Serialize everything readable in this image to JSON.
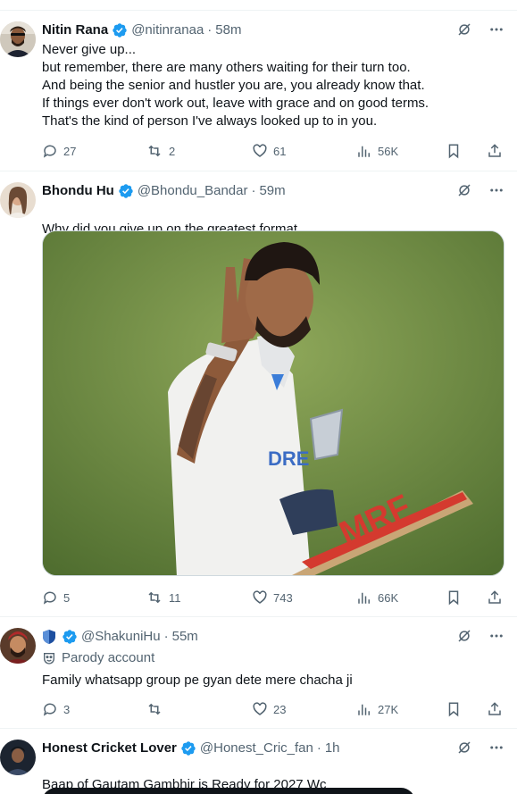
{
  "tweets": [
    {
      "name": "Nitin Rana",
      "handle": "@nitinranaa",
      "time": "58m",
      "text": "Never give up...\nbut remember, there are many others waiting for their turn too.\nAnd being the senior and hustler you are, you already know that.\nIf things ever don't work out, leave with grace and on good terms.\nThat's the kind of person I've always looked up to in you.",
      "replies": "27",
      "retweets": "2",
      "likes": "61",
      "views": "56K"
    },
    {
      "name": "Bhondu Hu",
      "handle": "@Bhondu_Bandar",
      "time": "59m",
      "text": "Why did you give up on the greatest format",
      "replies": "5",
      "retweets": "11",
      "likes": "743",
      "views": "66K"
    },
    {
      "name": "",
      "handle": "@ShakuniHu",
      "time": "55m",
      "parody_label": "Parody account",
      "text": "Family whatsapp group pe gyan dete mere chacha ji",
      "replies": "3",
      "retweets": "",
      "likes": "23",
      "views": "27K"
    },
    {
      "name": "Honest Cricket Lover",
      "handle": "@Honest_Cric_fan",
      "time": "1h",
      "text": "Baap of Gautam Gambhir is Ready for 2027 Wc"
    }
  ],
  "media": {
    "bat_brand": "MRF",
    "jersey_text": "DRE"
  },
  "colors": {
    "verified": "#1d9bf0",
    "text": "#0f1419",
    "secondary": "#536471",
    "border": "#eff3f4"
  },
  "icons": [
    "grok-icon",
    "more-icon",
    "reply-icon",
    "retweet-icon",
    "like-icon",
    "views-icon",
    "bookmark-icon",
    "share-icon",
    "verified-icon",
    "shield-icon",
    "parody-mask-icon"
  ]
}
